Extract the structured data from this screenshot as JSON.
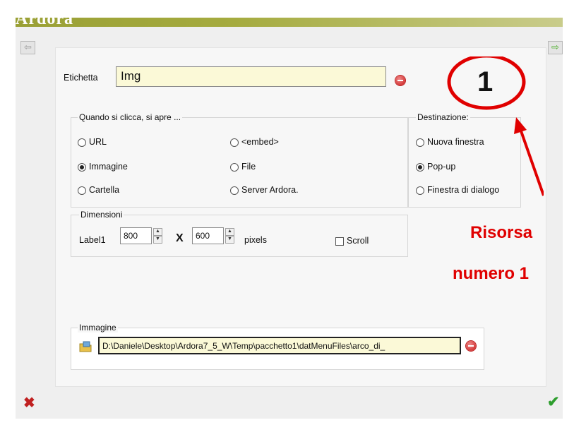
{
  "app": {
    "title": "Ardora"
  },
  "nav": {
    "prev_icon": "⇦",
    "next_icon": "⇨"
  },
  "etichetta": {
    "label": "Etichetta",
    "value": "Img"
  },
  "when_click": {
    "legend": "Quando si clicca, si apre ...",
    "options": [
      {
        "label": "URL",
        "selected": false
      },
      {
        "label": "<embed>",
        "selected": false
      },
      {
        "label": "Immagine",
        "selected": true
      },
      {
        "label": "File",
        "selected": false
      },
      {
        "label": "Cartella",
        "selected": false
      },
      {
        "label": "Server Ardora.",
        "selected": false
      }
    ]
  },
  "destination": {
    "legend": "Destinazione:",
    "options": [
      {
        "label": "Nuova finestra",
        "selected": false
      },
      {
        "label": "Pop-up",
        "selected": true
      },
      {
        "label": "Finestra di dialogo",
        "selected": false
      }
    ]
  },
  "dimensions": {
    "legend": "Dimensioni",
    "label": "Label1",
    "width": "800",
    "times": "X",
    "height": "600",
    "unit": "pixels",
    "scroll_label": "Scroll",
    "scroll_checked": false
  },
  "image": {
    "legend": "Immagine",
    "path": "D:\\Daniele\\Desktop\\Ardora7_5_W\\Temp\\pacchetto1\\datMenuFiles\\arco_di_"
  },
  "annotation": {
    "number": "1",
    "line1": "Risorsa",
    "line2": "numero 1",
    "color": "#e00000"
  },
  "footer": {
    "cancel_icon": "✖",
    "ok_icon": "✔"
  }
}
